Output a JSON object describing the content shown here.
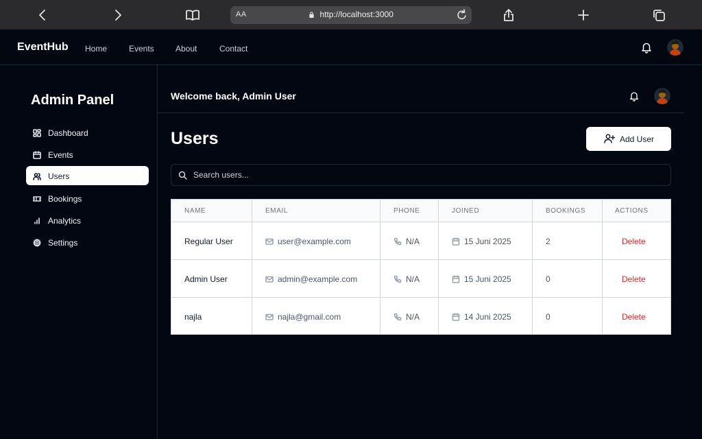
{
  "browser": {
    "aa_label": "AA",
    "url": "http://localhost:3000"
  },
  "site_nav": {
    "brand": "EventHub",
    "links": [
      "Home",
      "Events",
      "About",
      "Contact"
    ]
  },
  "sidebar": {
    "title": "Admin Panel",
    "items": [
      {
        "label": "Dashboard",
        "icon": "dashboard-icon"
      },
      {
        "label": "Events",
        "icon": "calendar-icon"
      },
      {
        "label": "Users",
        "icon": "users-icon",
        "active": true
      },
      {
        "label": "Bookings",
        "icon": "ticket-icon"
      },
      {
        "label": "Analytics",
        "icon": "bar-chart-icon"
      },
      {
        "label": "Settings",
        "icon": "gear-icon"
      }
    ]
  },
  "main": {
    "welcome": "Welcome back, Admin User",
    "page_title": "Users",
    "add_user_label": "Add User",
    "search_placeholder": "Search users...",
    "table": {
      "headers": [
        "NAME",
        "EMAIL",
        "PHONE",
        "JOINED",
        "BOOKINGS",
        "ACTIONS"
      ],
      "rows": [
        {
          "name": "Regular User",
          "email": "user@example.com",
          "phone": "N/A",
          "joined": "15 Juni 2025",
          "bookings": "2",
          "action": "Delete"
        },
        {
          "name": "Admin User",
          "email": "admin@example.com",
          "phone": "N/A",
          "joined": "15 Juni 2025",
          "bookings": "0",
          "action": "Delete"
        },
        {
          "name": "najla",
          "email": "najla@gmail.com",
          "phone": "N/A",
          "joined": "14 Juni 2025",
          "bookings": "0",
          "action": "Delete"
        }
      ]
    }
  },
  "colors": {
    "background": "#030712",
    "delete_action": "#dc2626",
    "active_item_bg": "#ffffff"
  }
}
